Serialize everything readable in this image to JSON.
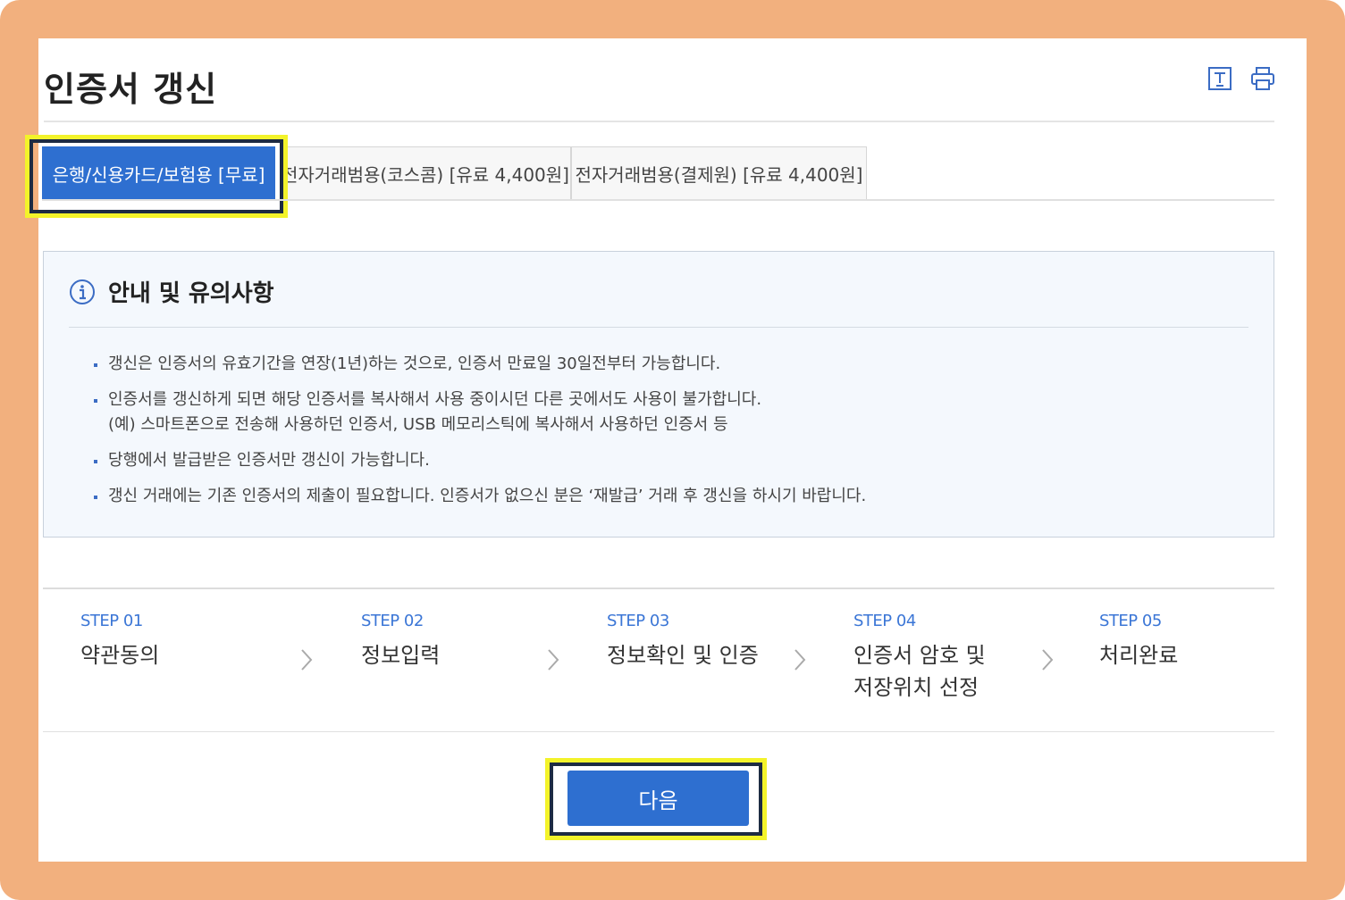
{
  "page": {
    "title": "인증서 갱신",
    "font_size_icon": "font-size-icon",
    "print_icon": "print-icon"
  },
  "tabs": [
    {
      "label": "은행/신용카드/보험용 [무료]",
      "active": true
    },
    {
      "label": "전자거래범용(코스콤) [유료 4,400원]",
      "active": false
    },
    {
      "label": "전자거래범용(결제원) [유료 4,400원]",
      "active": false
    }
  ],
  "notice": {
    "title": "안내 및 유의사항",
    "items": [
      {
        "text": "갱신은 인증서의 유효기간을 연장(1년)하는 것으로, 인증서 만료일 30일전부터 가능합니다.",
        "sub": ""
      },
      {
        "text": "인증서를 갱신하게 되면 해당 인증서를 복사해서 사용 중이시던 다른 곳에서도 사용이 불가합니다.",
        "sub": "(예) 스마트폰으로 전송해 사용하던 인증서, USB 메모리스틱에 복사해서 사용하던 인증서 등"
      },
      {
        "text": "당행에서 발급받은 인증서만 갱신이 가능합니다.",
        "sub": ""
      },
      {
        "text": "갱신 거래에는 기존 인증서의 제출이 필요합니다. 인증서가 없으신 분은 ‘재발급’ 거래 후 갱신을 하시기 바랍니다.",
        "sub": ""
      }
    ]
  },
  "steps": [
    {
      "num": "STEP 01",
      "label": "약관동의"
    },
    {
      "num": "STEP 02",
      "label": "정보입력"
    },
    {
      "num": "STEP 03",
      "label": "정보확인 및 인증"
    },
    {
      "num": "STEP 04",
      "label": "인증서 암호 및 저장위치 선정"
    },
    {
      "num": "STEP 05",
      "label": "처리완료"
    }
  ],
  "next_button": "다음",
  "colors": {
    "frame": "#f2b07e",
    "accent": "#2e6fd0",
    "highlight": "#f3f32a"
  }
}
